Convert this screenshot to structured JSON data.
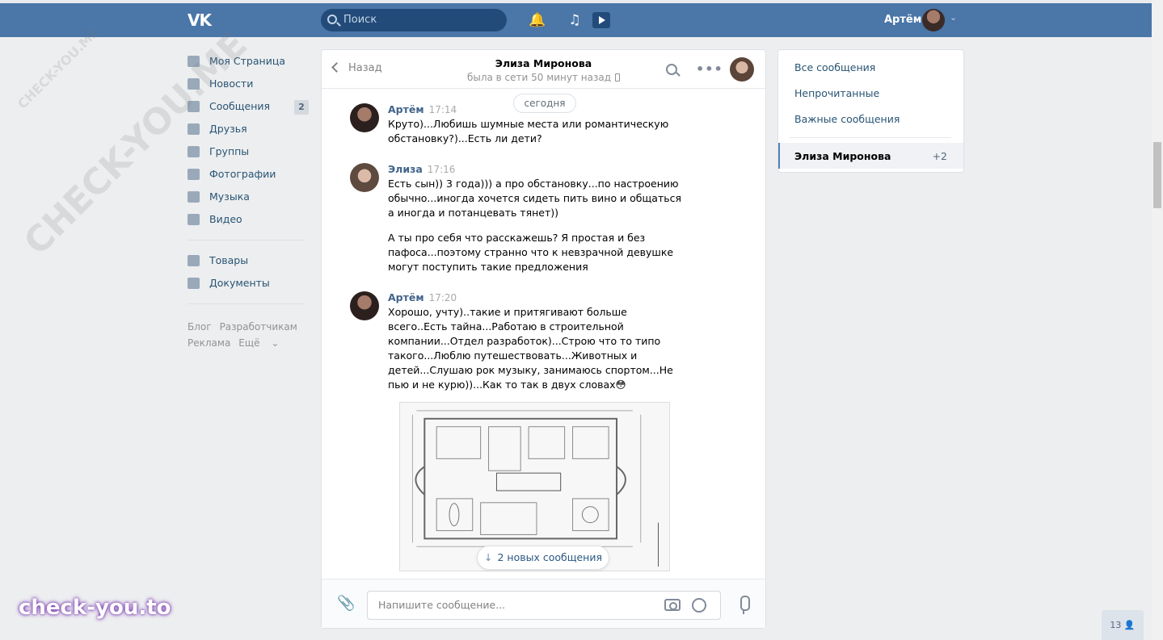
{
  "header": {
    "search_placeholder": "Поиск",
    "user_name": "Артём"
  },
  "leftnav": {
    "items": [
      {
        "label": "Моя Страница",
        "icon": "home-icon"
      },
      {
        "label": "Новости",
        "icon": "news-icon"
      },
      {
        "label": "Сообщения",
        "icon": "messages-icon",
        "badge": "2"
      },
      {
        "label": "Друзья",
        "icon": "friends-icon"
      },
      {
        "label": "Группы",
        "icon": "groups-icon"
      },
      {
        "label": "Фотографии",
        "icon": "photo-icon"
      },
      {
        "label": "Музыка",
        "icon": "music-icon"
      },
      {
        "label": "Видео",
        "icon": "video-icon"
      }
    ],
    "items2": [
      {
        "label": "Товары",
        "icon": "goods-icon"
      },
      {
        "label": "Документы",
        "icon": "documents-icon"
      }
    ],
    "footer": [
      "Блог",
      "Разработчикам",
      "Реклама",
      "Ещё"
    ]
  },
  "chat": {
    "back_label": "Назад",
    "peer_name": "Элиза Миронова",
    "peer_status": "была в сети 50 минут назад",
    "day_label": "сегодня",
    "messages": [
      {
        "author": "Артём",
        "time": "17:14",
        "text": "Круто)...Любишь шумные места или романтическую обстановку?)...Есть ли дети?"
      },
      {
        "author": "Элиза",
        "time": "17:16",
        "text": "Есть сын)) 3 года))) а про обстановку...по настроению обычно...иногда хочется сидеть пить вино и общаться а иногда и потанцевать тянет))",
        "text2": "А ты про себя что расскажешь? Я простая и без пафоса...поэтому странно что к невзрачной девушке могут поступить такие предложения"
      },
      {
        "author": "Артём",
        "time": "17:20",
        "text": "Хорошо, учту)..такие и притягивают больше всего..Есть тайна...Работаю в строительной компании...Отдел разработок)...Строю что то типо такого...Люблю путешествовать...Животных и детей...Слушаю рок музыку, занимаюсь спортом...Не пью и не курю))...Как то так в двух словах😳"
      }
    ],
    "new_messages_label": "2 новых сообщения",
    "input_placeholder": "Напишите сообщение..."
  },
  "rightpanel": {
    "items": [
      "Все сообщения",
      "Непрочитанные",
      "Важные сообщения"
    ],
    "selected_name": "Элиза Миронова",
    "selected_count": "+2"
  },
  "online_count": "13",
  "watermarks": {
    "big": "CHECK-YOU.ME",
    "site": "check-you.to"
  },
  "colors": {
    "header": "#4a76a8",
    "link": "#285473",
    "author": "#42648b"
  }
}
